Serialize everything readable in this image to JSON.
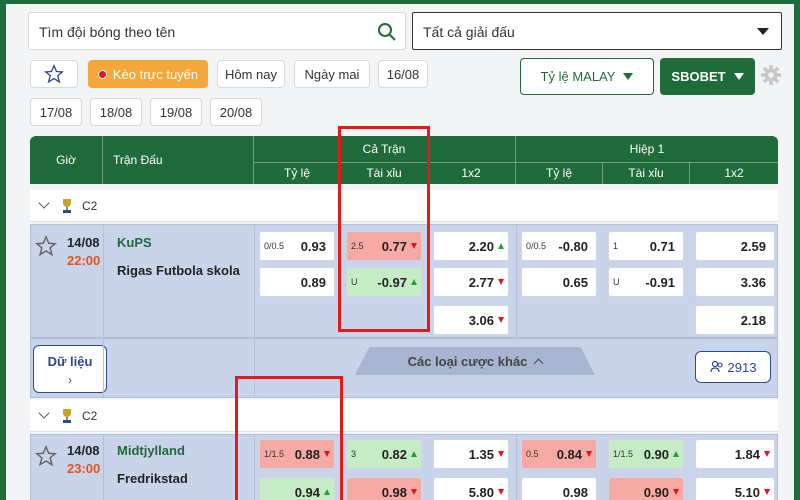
{
  "search": {
    "placeholder": "Tìm đội bóng theo tên"
  },
  "league_select": {
    "value": "Tất cả giải đấu"
  },
  "filters": {
    "live": "Kèo trực tuyến",
    "today": "Hôm nay",
    "tomorrow": "Ngày mai",
    "d1": "16/08",
    "d2": "17/08",
    "d3": "18/08",
    "d4": "19/08",
    "d5": "20/08"
  },
  "odds_type": "Tỷ lệ MALAY",
  "bookmaker": "SBOBET",
  "header": {
    "time": "Giờ",
    "match": "Trận Đấu",
    "full_time": "Cả Trận",
    "half": "Hiệp 1",
    "handicap": "Tỷ lệ",
    "over_under": "Tài xỉu",
    "x12": "1x2",
    "handicap2": "Tỷ lệ",
    "over_under2": "Tài xỉu",
    "x12_2": "1x2"
  },
  "matches": [
    {
      "league": "C2",
      "date": "14/08",
      "time": "22:00",
      "home": "KuPS",
      "away": "Rigas Futbola skola",
      "ft_hdp": [
        {
          "hc": "0/0.5",
          "od": "0.93"
        },
        {
          "hc": "",
          "od": "0.89"
        }
      ],
      "ft_ou": [
        {
          "hc": "2.5",
          "od": "0.77"
        },
        {
          "hc": "U",
          "od": "-0.97"
        }
      ],
      "ft_1x2": [
        "2.20",
        "2.77",
        "3.06"
      ],
      "h1_hdp": [
        {
          "hc": "0/0.5",
          "od": "-0.80"
        },
        {
          "hc": "",
          "od": "0.65"
        }
      ],
      "h1_ou": [
        {
          "hc": "1",
          "od": "0.71"
        },
        {
          "hc": "U",
          "od": "-0.91"
        }
      ],
      "h1_1x2": [
        "2.59",
        "3.36",
        "2.18"
      ],
      "data_label": "Dữ liệu",
      "more_bets": "Các loại cược khác",
      "bet_count": "2913"
    },
    {
      "league": "C2",
      "date": "14/08",
      "time": "23:00",
      "home": "Midtjylland",
      "away": "Fredrikstad",
      "ft_hdp": [
        {
          "hc": "1/1.5",
          "od": "0.88"
        },
        {
          "hc": "",
          "od": "0.94"
        }
      ],
      "ft_ou": [
        {
          "hc": "3",
          "od": "0.82"
        },
        {
          "hc": "",
          "od": "0.98"
        }
      ],
      "ft_1x2": [
        "1.35",
        "5.80"
      ],
      "h1_hdp": [
        {
          "hc": "0.5",
          "od": "0.84"
        },
        {
          "hc": "",
          "od": "0.98"
        }
      ],
      "h1_ou": [
        {
          "hc": "1/1.5",
          "od": "0.90"
        },
        {
          "hc": "",
          "od": "0.90"
        }
      ],
      "h1_1x2": [
        "1.84",
        "5.10"
      ]
    }
  ],
  "colors": {
    "brand": "#1f6b39",
    "live": "#f4a73a",
    "highlight": "#e21a1a"
  }
}
